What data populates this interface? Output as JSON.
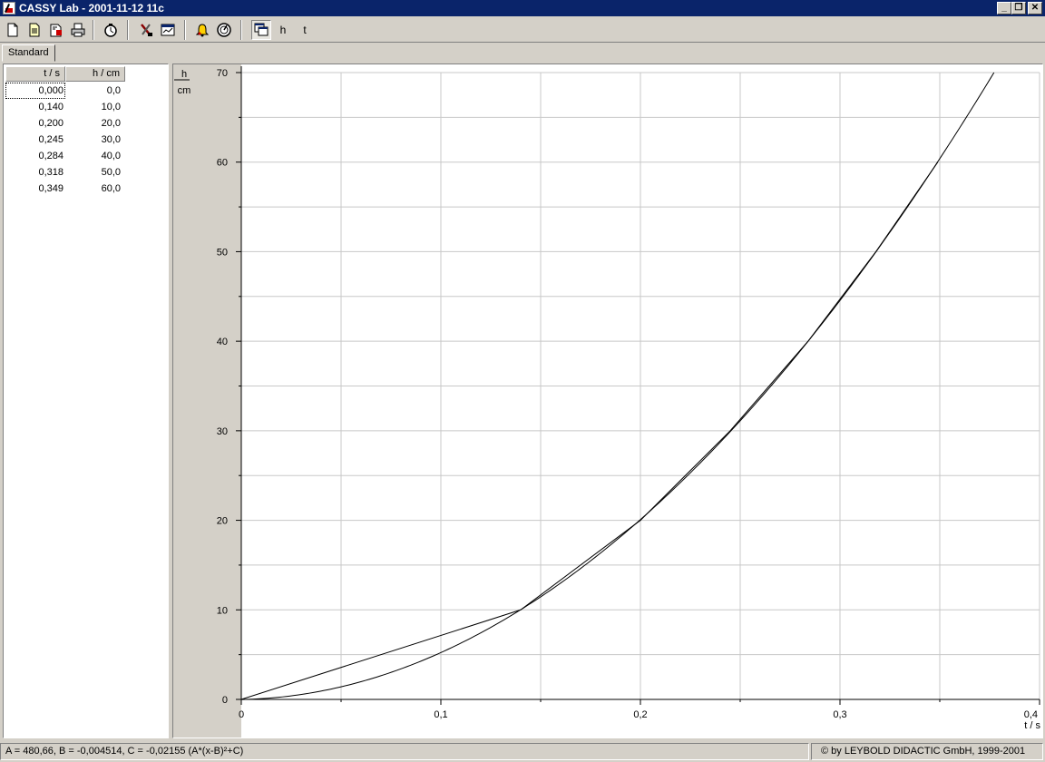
{
  "window": {
    "title": "CASSY Lab - 2001-11-12 11c",
    "minimize_label": "_",
    "restore_label": "❐",
    "close_label": "✕"
  },
  "toolbar": {
    "buttons": [
      {
        "icon": "new-document-icon"
      },
      {
        "icon": "open-document-icon"
      },
      {
        "icon": "save-document-icon"
      },
      {
        "icon": "print-icon"
      },
      {
        "icon": "stopwatch-icon"
      },
      {
        "icon": "settings-tools-icon"
      },
      {
        "icon": "display-window-icon"
      },
      {
        "icon": "warning-bell-icon"
      },
      {
        "icon": "measurement-dial-icon"
      },
      {
        "icon": "window-select-icon"
      }
    ],
    "text_buttons": [
      "h",
      "t"
    ]
  },
  "tabs": [
    "Standard"
  ],
  "table": {
    "headers": [
      "t / s",
      "h / cm"
    ],
    "rows": [
      [
        "0,000",
        "0,0"
      ],
      [
        "0,140",
        "10,0"
      ],
      [
        "0,200",
        "20,0"
      ],
      [
        "0,245",
        "30,0"
      ],
      [
        "0,284",
        "40,0"
      ],
      [
        "0,318",
        "50,0"
      ],
      [
        "0,349",
        "60,0"
      ]
    ]
  },
  "chart_data": {
    "type": "line",
    "xlabel": "t / s",
    "ylabel_top": "h",
    "ylabel_bottom": "cm",
    "xlim": [
      0,
      0.4
    ],
    "ylim": [
      0,
      70
    ],
    "x_ticks": [
      "0",
      "0,1",
      "0,2",
      "0,3",
      "0,4"
    ],
    "x_tick_values": [
      0,
      0.1,
      0.2,
      0.3,
      0.4
    ],
    "y_ticks": [
      "0",
      "10",
      "20",
      "30",
      "40",
      "50",
      "60",
      "70"
    ],
    "y_tick_values": [
      0,
      10,
      20,
      30,
      40,
      50,
      60,
      70
    ],
    "grid": true,
    "series": [
      {
        "kind": "measured",
        "x": [
          0.0,
          0.14,
          0.2,
          0.245,
          0.284,
          0.318,
          0.349
        ],
        "y": [
          0.0,
          10.0,
          20.0,
          30.0,
          40.0,
          50.0,
          60.0
        ]
      },
      {
        "kind": "fit",
        "model": "A*(x-B)^2+C",
        "A": 480.66,
        "B": -0.004514,
        "C": -0.02155
      }
    ]
  },
  "status": {
    "fit_text": "A = 480,66,   B = -0,004514,   C = -0,02155   (A*(x-B)²+C)",
    "copyright": "© by LEYBOLD DIDACTIC GmbH, 1999-2001"
  }
}
